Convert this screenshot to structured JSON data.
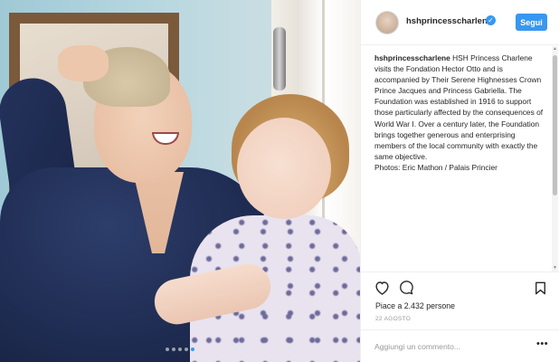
{
  "post": {
    "photo_alt": "photo",
    "carousel_dot_count": 5,
    "carousel_active_index": 4
  },
  "header": {
    "avatar_icon": "user-avatar",
    "username": "hshprincesscharlene",
    "verified_icon": "verified-badge-icon",
    "follow_label": "Segui"
  },
  "caption": {
    "username": "hshprincesscharlene",
    "text": "HSH Princess Charlene visits the Fondation Hector Otto and is accompanied by Their Serene Highnesses Crown Prince Jacques and Princess Gabriella. The Foundation was established in 1916 to support those particularly affected by the consequences of World War I. Over a century later, the Foundation brings together generous and enterprising members of the local community with exactly the same objective.",
    "credit": "Photos: Eric Mathon / Palais Princier"
  },
  "actions": {
    "like_icon": "heart-icon",
    "comment_icon": "comment-bubble-icon",
    "save_icon": "bookmark-icon",
    "likes_text": "Piace a 2.432 persone",
    "date": "22 AGOSTO"
  },
  "comment": {
    "placeholder": "Aggiungi un commento...",
    "more_label": "•••"
  },
  "colors": {
    "accent": "#3897f0",
    "border": "#efefef",
    "text": "#262626",
    "muted": "#999999"
  }
}
